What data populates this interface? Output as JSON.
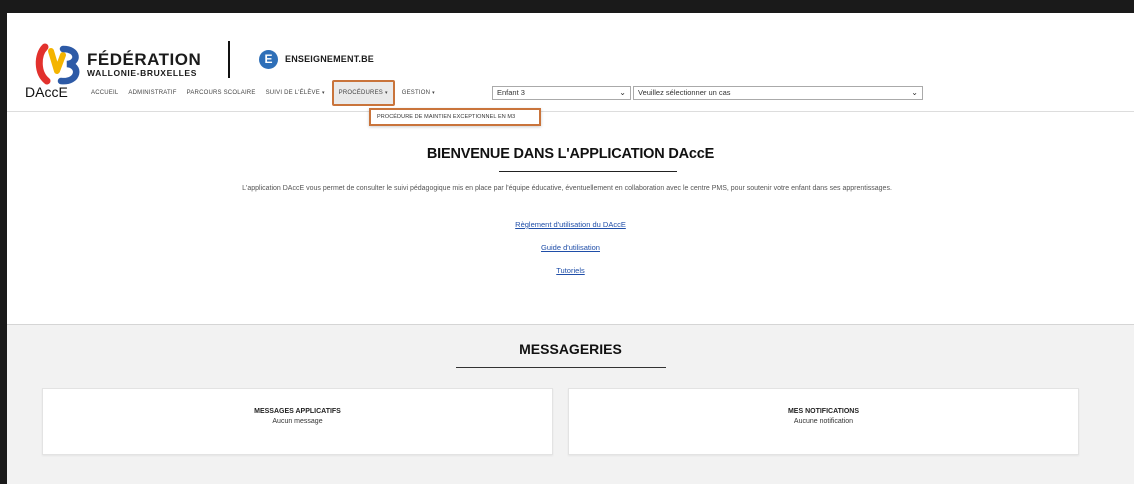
{
  "header": {
    "fwb_line1": "FÉDÉRATION",
    "fwb_line2": "WALLONIE-BRUXELLES",
    "ens_badge": "E",
    "ens_name": "ENSEIGNEMENT.BE",
    "brand": "DAccE"
  },
  "nav": {
    "items": [
      {
        "label": "ACCUEIL",
        "has_caret": false
      },
      {
        "label": "ADMINISTRATIF",
        "has_caret": false
      },
      {
        "label": "PARCOURS SCOLAIRE",
        "has_caret": false
      },
      {
        "label": "SUIVI DE L'ÉLÈVE",
        "has_caret": true
      },
      {
        "label": "PROCÉDURES",
        "has_caret": true,
        "active": true
      },
      {
        "label": "GESTION",
        "has_caret": true
      }
    ],
    "caret": "▾",
    "child_select": "Enfant 3",
    "case_select": "Veuillez sélectionner un cas",
    "select_chevron": "⌄",
    "dropdown_item": "PROCÉDURE DE MAINTIEN EXCEPTIONNEL EN M3"
  },
  "welcome": {
    "title": "BIENVENUE DANS L'APPLICATION DAccE",
    "description": "L'application DAccE vous permet de consulter le suivi pédagogique mis en place par l'équipe éducative, éventuellement en collaboration avec le centre PMS, pour soutenir votre enfant dans ses apprentissages.",
    "links": [
      "Règlement d'utilisation du DAccE",
      "Guide d'utilisation",
      "Tutoriels"
    ]
  },
  "messaging": {
    "title": "MESSAGERIES",
    "cards": [
      {
        "title": "MESSAGES APPLICATIFS",
        "subtitle": "Aucun message"
      },
      {
        "title": "MES NOTIFICATIONS",
        "subtitle": "Aucune notification"
      }
    ]
  },
  "colors": {
    "highlight": "#c9743b",
    "link": "#1f4ea8",
    "ens_blue": "#2e6fb8",
    "fwb_red": "#e2312d",
    "fwb_yellow": "#f4b400",
    "fwb_blue": "#2d5aa6"
  }
}
